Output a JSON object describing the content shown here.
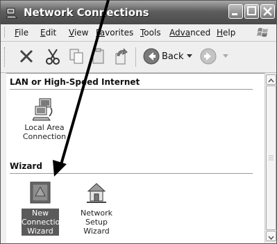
{
  "window": {
    "title": "Network Connections"
  },
  "menubar": {
    "items": [
      {
        "accel": "F",
        "rest": "ile"
      },
      {
        "accel": "E",
        "rest": "dit"
      },
      {
        "accel": "V",
        "rest": "iew"
      },
      {
        "accel": "Fa",
        "rest": "vorites"
      },
      {
        "accel": "T",
        "rest": "ools"
      },
      {
        "accel": "Adva",
        "rest": "nced"
      },
      {
        "accel": "H",
        "rest": "elp"
      }
    ]
  },
  "toolbar": {
    "back_label": "Back"
  },
  "content": {
    "groups": [
      {
        "label": "LAN or High-Speed Internet"
      },
      {
        "label": "Wizard"
      }
    ],
    "items": [
      {
        "line1": "Local Area",
        "line2": "Connection",
        "line3": ""
      },
      {
        "line1": "New",
        "line2": "Connection",
        "line3": "Wizard"
      },
      {
        "line1": "Network Setup",
        "line2": "Wizard",
        "line3": ""
      }
    ]
  }
}
